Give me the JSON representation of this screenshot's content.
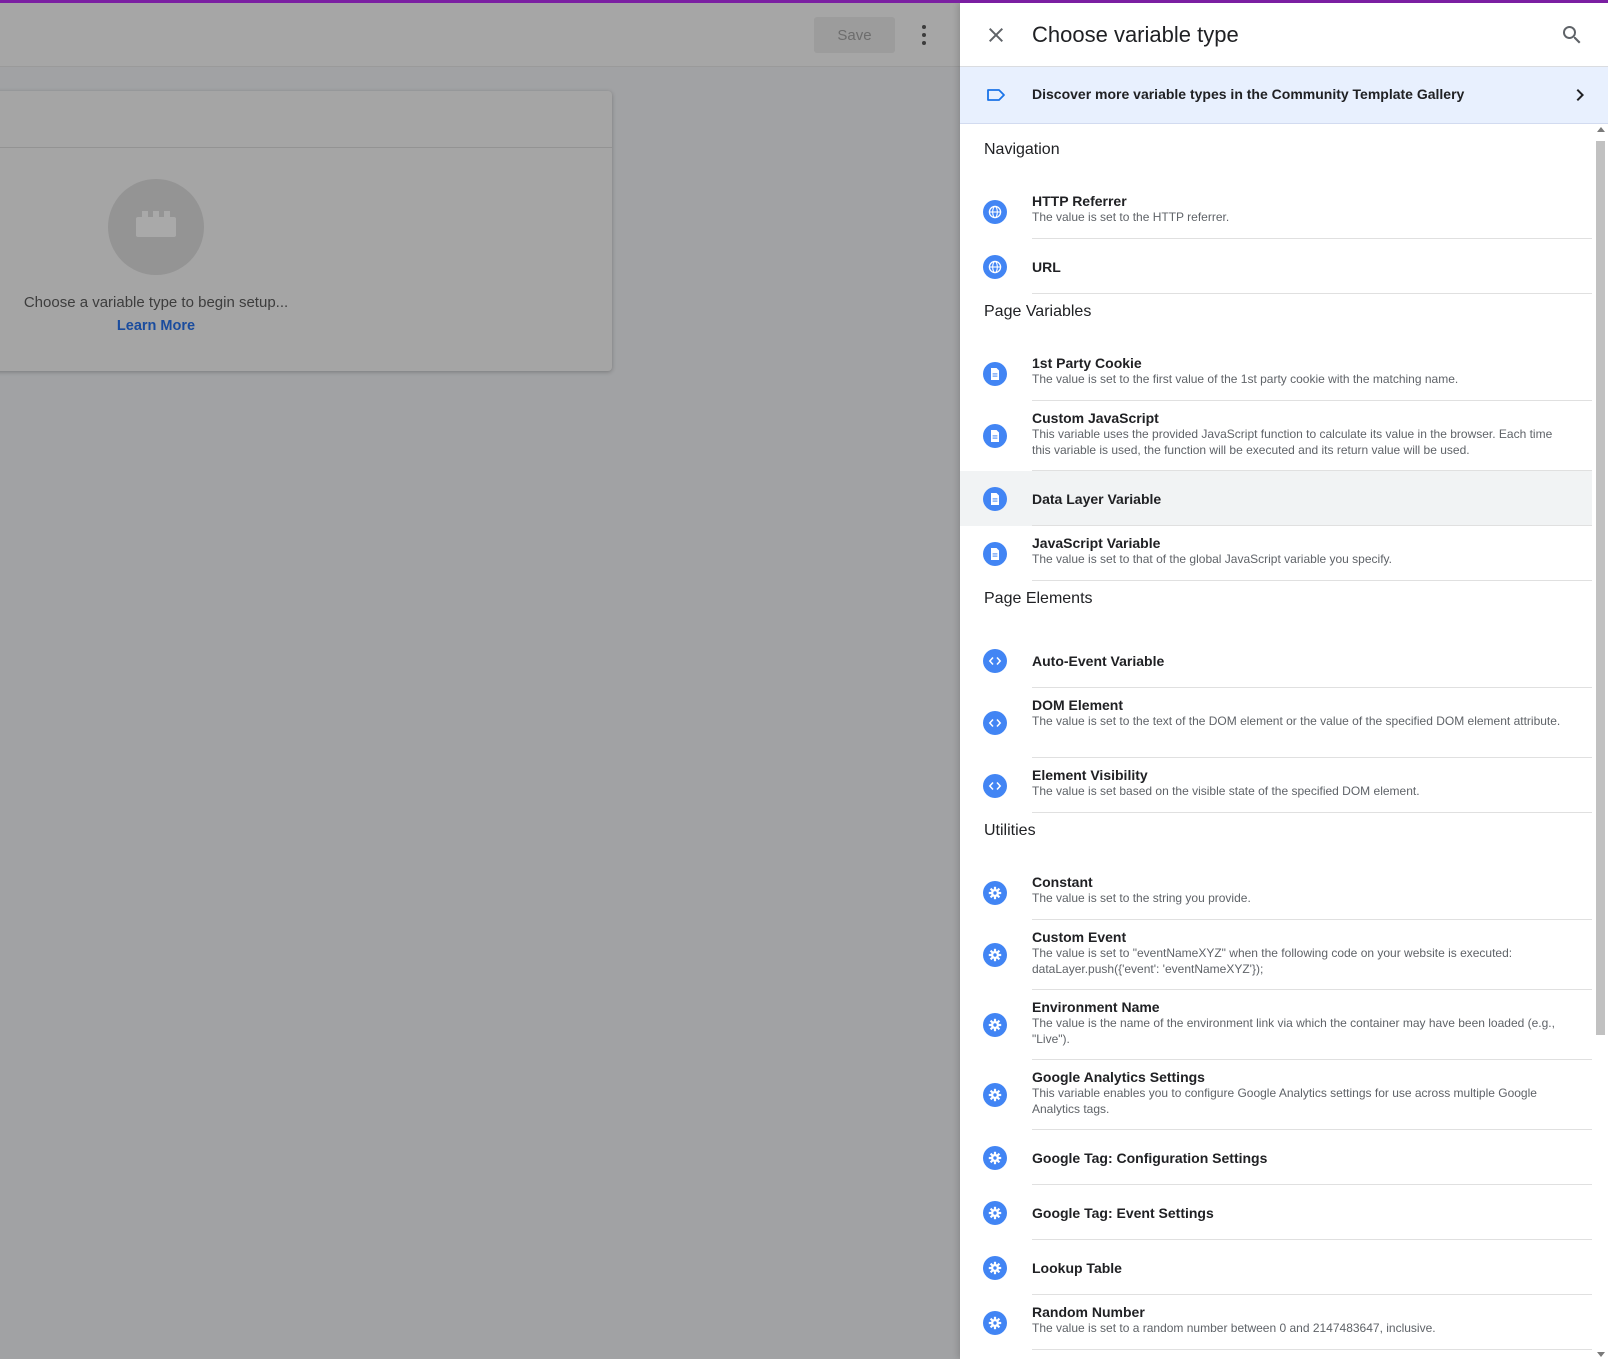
{
  "background": {
    "save_label": "Save",
    "card_text": "Choose a variable type to begin setup...",
    "card_link": "Learn More"
  },
  "panel": {
    "title": "Choose variable type",
    "banner": "Discover more variable types in the Community Template Gallery"
  },
  "colors": {
    "accent": "#4285f4",
    "top_bar": "#7b1fa2",
    "banner_bg": "#e8f0fe"
  },
  "sections": [
    {
      "title": "Navigation",
      "items": [
        {
          "name": "HTTP Referrer",
          "icon": "globe-icon",
          "desc": "The value is set to the HTTP referrer."
        },
        {
          "name": "URL",
          "icon": "globe-icon",
          "desc": ""
        }
      ]
    },
    {
      "title": "Page Variables",
      "items": [
        {
          "name": "1st Party Cookie",
          "icon": "document-icon",
          "desc": "The value is set to the first value of the 1st party cookie with the matching name."
        },
        {
          "name": "Custom JavaScript",
          "icon": "document-icon",
          "desc": "This variable uses the provided JavaScript function to calculate its value in the browser. Each time this variable is used, the function will be executed and its return value will be used."
        },
        {
          "name": "Data Layer Variable",
          "icon": "document-icon",
          "desc": ""
        },
        {
          "name": "JavaScript Variable",
          "icon": "document-icon",
          "desc": "The value is set to that of the global JavaScript variable you specify."
        }
      ]
    },
    {
      "title": "Page Elements",
      "items": [
        {
          "name": "Auto-Event Variable",
          "icon": "code-icon",
          "desc": ""
        },
        {
          "name": "DOM Element",
          "icon": "code-icon",
          "desc": "The value is set to the text of the DOM element or the value of the specified DOM element attribute."
        },
        {
          "name": "Element Visibility",
          "icon": "code-icon",
          "desc": "The value is set based on the visible state of the specified DOM element."
        }
      ]
    },
    {
      "title": "Utilities",
      "items": [
        {
          "name": "Constant",
          "icon": "gear-icon",
          "desc": "The value is set to the string you provide."
        },
        {
          "name": "Custom Event",
          "icon": "gear-icon",
          "desc": "The value is set to \"eventNameXYZ\" when the following code on your website is executed: dataLayer.push({'event': 'eventNameXYZ'});"
        },
        {
          "name": "Environment Name",
          "icon": "gear-icon",
          "desc": "The value is the name of the environment link via which the container may have been loaded (e.g., \"Live\")."
        },
        {
          "name": "Google Analytics Settings",
          "icon": "gear-icon",
          "desc": "This variable enables you to configure Google Analytics settings for use across multiple Google Analytics tags."
        },
        {
          "name": "Google Tag: Configuration Settings",
          "icon": "gear-icon",
          "desc": ""
        },
        {
          "name": "Google Tag: Event Settings",
          "icon": "gear-icon",
          "desc": ""
        },
        {
          "name": "Lookup Table",
          "icon": "gear-icon",
          "desc": ""
        },
        {
          "name": "Random Number",
          "icon": "gear-icon",
          "desc": "The value is set to a random number between 0 and 2147483647, inclusive."
        }
      ]
    }
  ]
}
